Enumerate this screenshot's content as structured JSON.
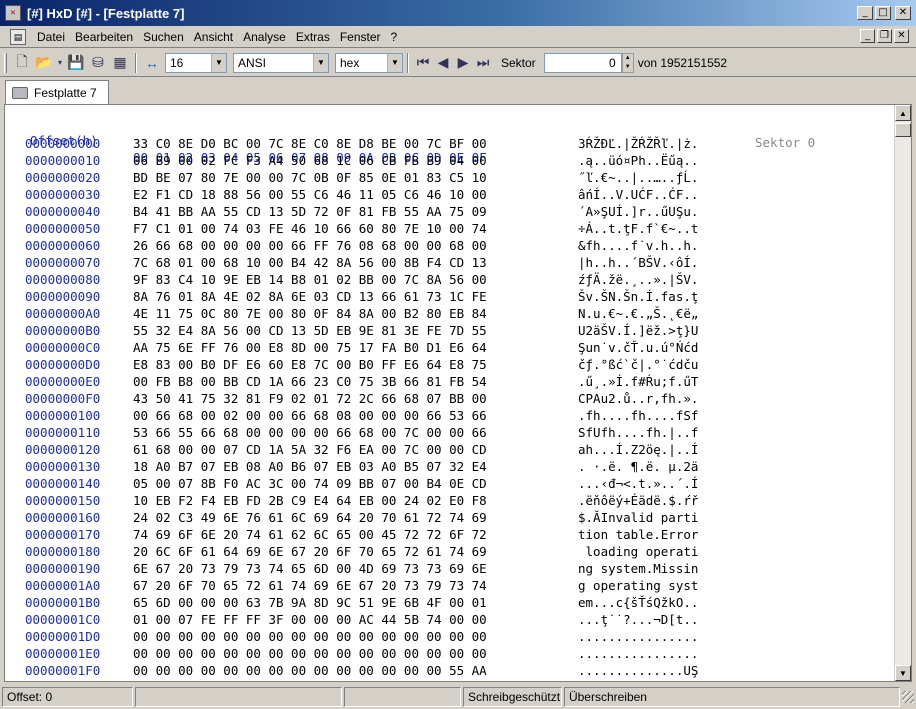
{
  "window": {
    "title": "[#] HxD [#] - [Festplatte 7]",
    "icon": "hxd-app-icon"
  },
  "menu": {
    "items": [
      {
        "key": "datei",
        "label": "Datei"
      },
      {
        "key": "bearbeiten",
        "label": "Bearbeiten"
      },
      {
        "key": "suchen",
        "label": "Suchen"
      },
      {
        "key": "ansicht",
        "label": "Ansicht"
      },
      {
        "key": "analyse",
        "label": "Analyse"
      },
      {
        "key": "extras",
        "label": "Extras"
      },
      {
        "key": "fenster",
        "label": "Fenster"
      },
      {
        "key": "hilfe",
        "label": "?"
      }
    ]
  },
  "toolbar": {
    "bytes_per_row": "16",
    "charset": "ANSI",
    "offset_base": "hex",
    "sektor_label": "Sektor",
    "sektor_value": "0",
    "sektor_total": "von 1952151552"
  },
  "tabs": [
    {
      "label": "Festplatte 7"
    }
  ],
  "editor": {
    "header_offset": "Offset(h)",
    "header_columns": "00 01 02 03 04 05 06 07 08 09 0A 0B 0C 0D 0E 0F",
    "sektor_note": "Sektor 0",
    "rows": [
      {
        "offset": "0000000000",
        "bytes": "33 C0 8E D0 BC 00 7C 8E C0 8E D8 BE 00 7C BF 00",
        "text": "3ŔŽĐĽ.|ŽŔŽŘľ.|ż."
      },
      {
        "offset": "0000000010",
        "bytes": "06 B9 00 02 FC F3 A4 50 68 1C 06 CB FB B9 04 00",
        "text": ".ą..üó¤Ph..Ëűą.."
      },
      {
        "offset": "0000000020",
        "bytes": "BD BE 07 80 7E 00 00 7C 0B 0F 85 0E 01 83 C5 10",
        "text": "˝ľ.€~..|..…..ƒĹ."
      },
      {
        "offset": "0000000030",
        "bytes": "E2 F1 CD 18 88 56 00 55 C6 46 11 05 C6 46 10 00",
        "text": "âńÍ..V.UĆF..ĆF.."
      },
      {
        "offset": "0000000040",
        "bytes": "B4 41 BB AA 55 CD 13 5D 72 0F 81 FB 55 AA 75 09",
        "text": "´A»ŞUÍ.]r..űUŞu."
      },
      {
        "offset": "0000000050",
        "bytes": "F7 C1 01 00 74 03 FE 46 10 66 60 80 7E 10 00 74",
        "text": "÷Á..t.ţF.f`€~..t"
      },
      {
        "offset": "0000000060",
        "bytes": "26 66 68 00 00 00 00 66 FF 76 08 68 00 00 68 00",
        "text": "&fh....f˙v.h..h."
      },
      {
        "offset": "0000000070",
        "bytes": "7C 68 01 00 68 10 00 B4 42 8A 56 00 8B F4 CD 13",
        "text": "|h..h..´BŠV.‹ôÍ."
      },
      {
        "offset": "0000000080",
        "bytes": "9F 83 C4 10 9E EB 14 B8 01 02 BB 00 7C 8A 56 00",
        "text": "źƒÄ.žë.¸..».|ŠV."
      },
      {
        "offset": "0000000090",
        "bytes": "8A 76 01 8A 4E 02 8A 6E 03 CD 13 66 61 73 1C FE",
        "text": "Šv.ŠN.Šn.Í.fas.ţ"
      },
      {
        "offset": "00000000A0",
        "bytes": "4E 11 75 0C 80 7E 00 80 0F 84 8A 00 B2 80 EB 84",
        "text": "N.u.€~.€.„Š.˛€ë„"
      },
      {
        "offset": "00000000B0",
        "bytes": "55 32 E4 8A 56 00 CD 13 5D EB 9E 81 3E FE 7D 55",
        "text": "U2äŠV.Í.]ëž.>ţ}U"
      },
      {
        "offset": "00000000C0",
        "bytes": "AA 75 6E FF 76 00 E8 8D 00 75 17 FA B0 D1 E6 64",
        "text": "Şun˙v.čŤ.u.ú°Ńćd"
      },
      {
        "offset": "00000000D0",
        "bytes": "E8 83 00 B0 DF E6 60 E8 7C 00 B0 FF E6 64 E8 75",
        "text": "čƒ.°ßć`č|.°˙ćdču"
      },
      {
        "offset": "00000000E0",
        "bytes": "00 FB B8 00 BB CD 1A 66 23 C0 75 3B 66 81 FB 54",
        "text": ".ű¸.»Í.f#Ŕu;f.űT"
      },
      {
        "offset": "00000000F0",
        "bytes": "43 50 41 75 32 81 F9 02 01 72 2C 66 68 07 BB 00",
        "text": "CPAu2.ů..r,fh.»."
      },
      {
        "offset": "0000000100",
        "bytes": "00 66 68 00 02 00 00 66 68 08 00 00 00 66 53 66",
        "text": ".fh....fh....fSf"
      },
      {
        "offset": "0000000110",
        "bytes": "53 66 55 66 68 00 00 00 00 66 68 00 7C 00 00 66",
        "text": "SfUfh....fh.|..f"
      },
      {
        "offset": "0000000120",
        "bytes": "61 68 00 00 07 CD 1A 5A 32 F6 EA 00 7C 00 00 CD",
        "text": "ah...Í.Z2öę.|..Í"
      },
      {
        "offset": "0000000130",
        "bytes": "18 A0 B7 07 EB 08 A0 B6 07 EB 03 A0 B5 07 32 E4",
        "text": ". ·.ë. ¶.ë. µ.2ä"
      },
      {
        "offset": "0000000140",
        "bytes": "05 00 07 8B F0 AC 3C 00 74 09 BB 07 00 B4 0E CD",
        "text": "...‹đ¬<.t.»..´.Í"
      },
      {
        "offset": "0000000150",
        "bytes": "10 EB F2 F4 EB FD 2B C9 E4 64 EB 00 24 02 E0 F8",
        "text": ".ëňôëý+Éädë.$.ŕř"
      },
      {
        "offset": "0000000160",
        "bytes": "24 02 C3 49 6E 76 61 6C 69 64 20 70 61 72 74 69",
        "text": "$.ĂInvalid parti"
      },
      {
        "offset": "0000000170",
        "bytes": "74 69 6F 6E 20 74 61 62 6C 65 00 45 72 72 6F 72",
        "text": "tion table.Error"
      },
      {
        "offset": "0000000180",
        "bytes": "20 6C 6F 61 64 69 6E 67 20 6F 70 65 72 61 74 69",
        "text": " loading operati"
      },
      {
        "offset": "0000000190",
        "bytes": "6E 67 20 73 79 73 74 65 6D 00 4D 69 73 73 69 6E",
        "text": "ng system.Missin"
      },
      {
        "offset": "00000001A0",
        "bytes": "67 20 6F 70 65 72 61 74 69 6E 67 20 73 79 73 74",
        "text": "g operating syst"
      },
      {
        "offset": "00000001B0",
        "bytes": "65 6D 00 00 00 63 7B 9A 8D 9C 51 9E 6B 4F 00 01",
        "text": "em...c{šŤśQžkO.."
      },
      {
        "offset": "00000001C0",
        "bytes": "01 00 07 FE FF FF 3F 00 00 00 AC 44 5B 74 00 00",
        "text": "...ţ˙˙?...¬D[t.."
      },
      {
        "offset": "00000001D0",
        "bytes": "00 00 00 00 00 00 00 00 00 00 00 00 00 00 00 00",
        "text": "................"
      },
      {
        "offset": "00000001E0",
        "bytes": "00 00 00 00 00 00 00 00 00 00 00 00 00 00 00 00",
        "text": "................"
      },
      {
        "offset": "00000001F0",
        "bytes": "00 00 00 00 00 00 00 00 00 00 00 00 00 00 55 AA",
        "text": "..............UŞ"
      }
    ]
  },
  "status": {
    "offset": "Offset: 0",
    "write_protect": "Schreibgeschützt",
    "mode": "Überschreiben"
  }
}
